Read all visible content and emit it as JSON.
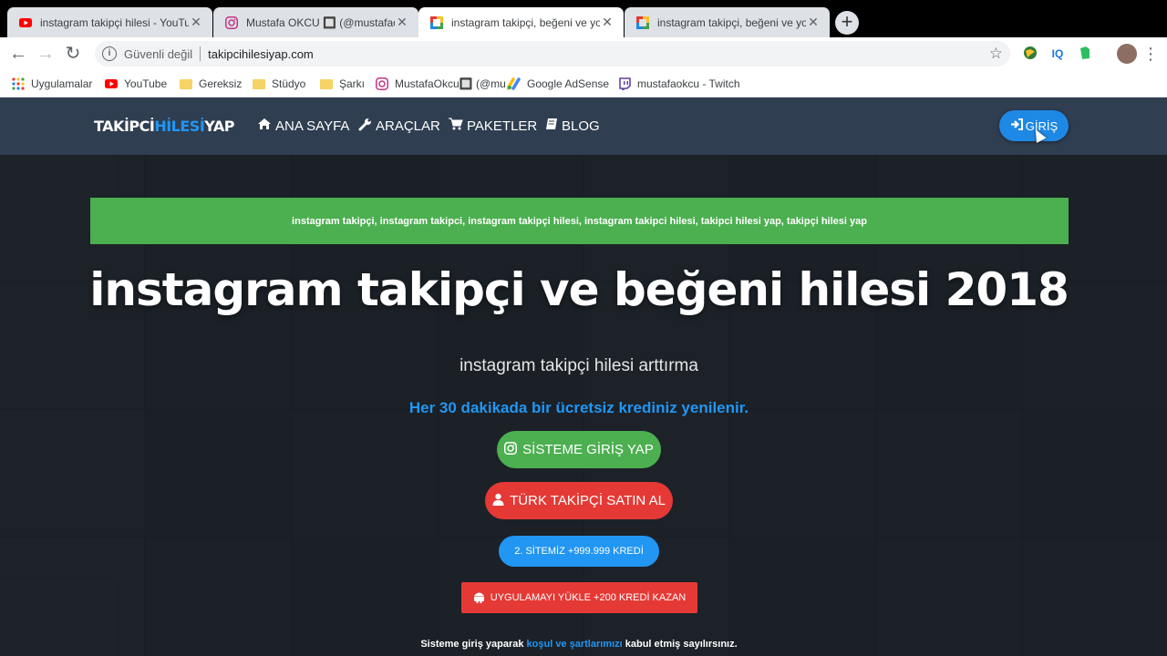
{
  "browser": {
    "tabs": [
      {
        "title": "instagram takipçi hilesi - YouTub",
        "favicon": "youtube-icon"
      },
      {
        "title": "Mustafa OKCU 🔲 (@mustafaokcu",
        "favicon": "instagram-icon"
      },
      {
        "title": "instagram takipçi, beğeni ve yoru",
        "favicon": "site-icon",
        "active": true
      },
      {
        "title": "instagram takipçi, beğeni ve yoru",
        "favicon": "site-icon"
      }
    ],
    "close_glyph": "✕",
    "new_tab_glyph": "+",
    "security_label": "Güvenli değil",
    "url": "takipcihilesiyap.com",
    "extensions": [
      "IQ"
    ],
    "bookmarks": [
      {
        "label": "Uygulamalar",
        "icon": "apps-grid-icon"
      },
      {
        "label": "YouTube",
        "icon": "youtube-icon"
      },
      {
        "label": "Gereksiz",
        "icon": "folder-icon"
      },
      {
        "label": "Stüdyo",
        "icon": "folder-icon"
      },
      {
        "label": "Şarkı",
        "icon": "folder-icon"
      },
      {
        "label": "MustafaOkcu🔲 (@mu",
        "icon": "instagram-icon"
      },
      {
        "label": "Google AdSense",
        "icon": "adsense-icon"
      },
      {
        "label": "mustafaokcu - Twitch",
        "icon": "twitch-icon"
      }
    ]
  },
  "site": {
    "logo": {
      "part1": "TAKİPCİ",
      "part2": "HİLESİ",
      "part3": "YAP"
    },
    "nav": [
      {
        "label": "ANA SAYFA",
        "icon": "home-icon"
      },
      {
        "label": "ARAÇLAR",
        "icon": "wrench-icon"
      },
      {
        "label": "PAKETLER",
        "icon": "cart-icon"
      },
      {
        "label": "BLOG",
        "icon": "book-icon"
      }
    ],
    "login_label": "GİRİŞ",
    "keywords": "instagram takipçi, instagram takipci, instagram takipçi hilesi, instagram takipci hilesi, takipci hilesi yap, takipçi hilesi yap",
    "title": "instagram takipçi ve beğeni hilesi 2018",
    "subtitle": "instagram takipçi hilesi arttırma",
    "notice": "Her 30 dakikada bir ücretsiz krediniz yenilenir.",
    "buttons": {
      "system_login": "SİSTEME GİRİŞ YAP",
      "buy_followers": "TÜRK TAKİPÇİ SATIN AL",
      "site2": "2. SİTEMİZ +999.999 KREDİ",
      "install_app": "UYGULAMAYI YÜKLE +200 KREDİ KAZAN"
    },
    "terms": {
      "before": "Sisteme giriş yaparak ",
      "link": "koşul ve şartlarımızı",
      "after": " kabul etmiş sayılırsınız."
    },
    "colors": {
      "accent": "#2196f3",
      "green": "#4caf50",
      "red": "#e53935",
      "navbar": "#2f3e50"
    }
  }
}
